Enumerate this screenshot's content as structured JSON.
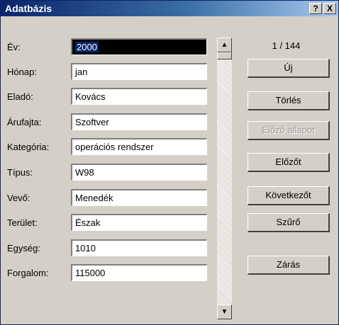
{
  "window": {
    "title": "Adatbázis"
  },
  "title_buttons": {
    "help": "?",
    "close": "X"
  },
  "fields": [
    {
      "label": "Év:",
      "value": "2000",
      "selected": true
    },
    {
      "label": "Hónap:",
      "value": "jan"
    },
    {
      "label": "Eladó:",
      "value": "Kovács"
    },
    {
      "label": "Árufajta:",
      "value": "Szoftver"
    },
    {
      "label": "Kategória:",
      "value": "operációs rendszer"
    },
    {
      "label": "Típus:",
      "value": "W98"
    },
    {
      "label": "Vevő:",
      "value": "Menedék"
    },
    {
      "label": "Terület:",
      "value": "Észak"
    },
    {
      "label": "Egység:",
      "value": "1010"
    },
    {
      "label": "Forgalom:",
      "value": "115000"
    }
  ],
  "record_counter": "1 / 144",
  "buttons": {
    "new": "Új",
    "delete": "Törlés",
    "restore": "Előző állapot",
    "previous": "Előzőt",
    "next": "Következőt",
    "filter": "Szűrő",
    "close": "Zárás"
  },
  "scrollbar": {
    "up_icon": "▲",
    "down_icon": "▼"
  }
}
